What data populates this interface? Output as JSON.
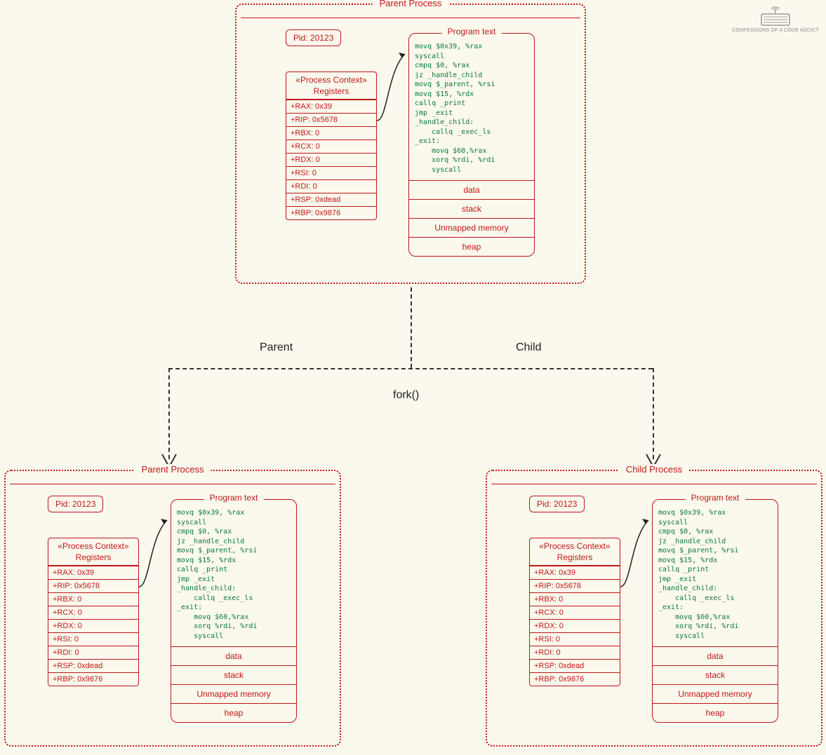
{
  "watermark": "CONFESSIONS OF A CODE ADDICT",
  "labels": {
    "parent": "Parent",
    "child": "Child",
    "fork": "fork()"
  },
  "shared": {
    "context_title": "«Process Context»",
    "context_sub": "Registers",
    "pid_label": "Pid: 20123",
    "mem_title": "Program text",
    "registers": [
      "+RAX: 0x39",
      "+RIP: 0x5678",
      "+RBX: 0",
      "+RCX: 0",
      "+RDX: 0",
      "+RSI: 0",
      "+RDI: 0",
      "+RSP: 0xdead",
      "+RBP: 0x9876"
    ],
    "code": "movq $0x39, %rax\nsyscall\ncmpq $0, %rax\njz _handle_child\nmovq $_parent, %rsi\nmovq $15, %rdx\ncallq _print\njmp _exit\n_handle_child:\n    callq _exec_ls\n_exit:\n    movq $60,%rax\n    xorq %rdi, %rdi\n    syscall",
    "mem_sections": [
      "data",
      "stack",
      "Unmapped memory",
      "heap"
    ]
  },
  "boxes": {
    "top": {
      "title": "Parent Process"
    },
    "left": {
      "title": "Parent Process"
    },
    "right": {
      "title": "Child Process"
    }
  }
}
